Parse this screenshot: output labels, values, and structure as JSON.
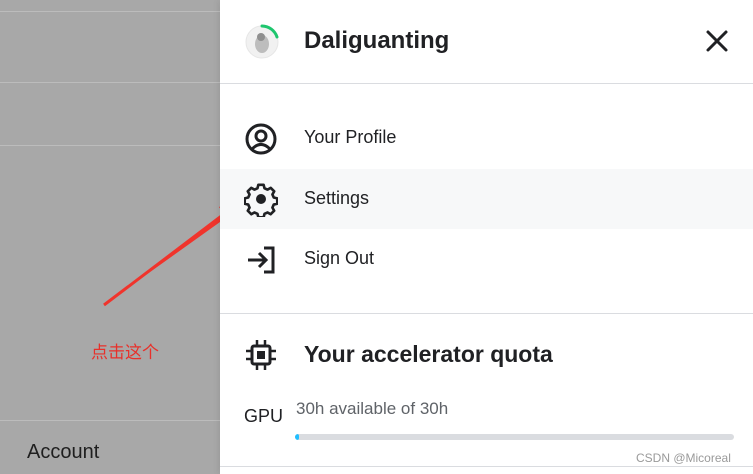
{
  "background": {
    "account_label": "Account"
  },
  "annotation": {
    "text": "点击这个",
    "color": "#e8302a"
  },
  "panel": {
    "username": "Daliguanting",
    "avatar_icon": "user-avatar-icon",
    "close_icon": "close-icon",
    "menu": [
      {
        "label": "Your Profile",
        "icon": "profile-icon"
      },
      {
        "label": "Settings",
        "icon": "gear-icon"
      },
      {
        "label": "Sign Out",
        "icon": "sign-out-icon"
      }
    ],
    "quota": {
      "title": "Your accelerator quota",
      "icon": "chip-icon",
      "gpu_label": "GPU",
      "gpu_available": "30h available of 30h",
      "progress_fraction": 0.01,
      "progress_color": "#20beff"
    }
  },
  "watermark": "CSDN @Micoreal"
}
